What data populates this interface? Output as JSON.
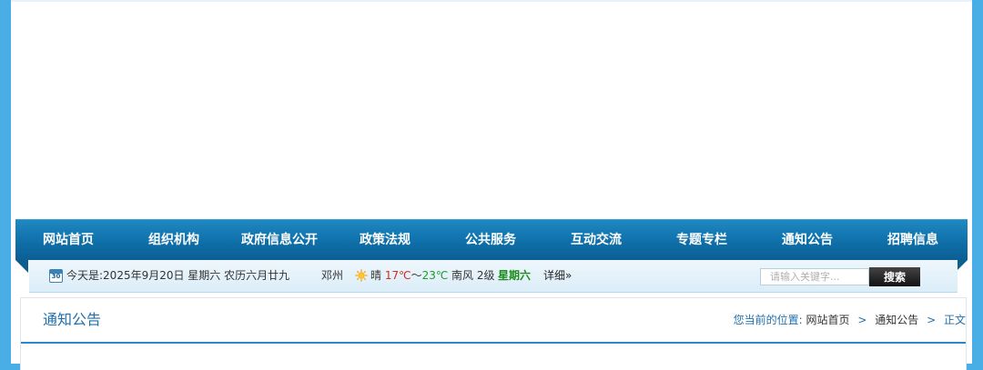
{
  "nav": {
    "items": [
      {
        "label": "网站首页"
      },
      {
        "label": "组织机构"
      },
      {
        "label": "政府信息公开"
      },
      {
        "label": "政策法规"
      },
      {
        "label": "公共服务"
      },
      {
        "label": "互动交流"
      },
      {
        "label": "专题专栏"
      },
      {
        "label": "通知公告"
      },
      {
        "label": "招聘信息"
      }
    ]
  },
  "info": {
    "calendar_day": "30",
    "date_text": "今天是:2025年9月20日 星期六 农历六月廿九",
    "city": "邓州",
    "weather_desc": "晴",
    "temp_high": "17℃",
    "temp_sep": "～",
    "temp_low": "23℃",
    "wind": "南风 2级",
    "weekday": "星期六",
    "detail_label": "详细»"
  },
  "search": {
    "placeholder": "请输入关键字...",
    "button_label": "搜索"
  },
  "content": {
    "section_title": "通知公告",
    "breadcrumb": {
      "prefix": "您当前的位置:",
      "home": "网站首页",
      "sep": ">",
      "category": "通知公告",
      "current": "正文"
    }
  },
  "colors": {
    "side_background": "#4aaee6",
    "nav_blue": "#0f6fa9",
    "accent_blue": "#1f6fab",
    "temp_high": "#d02b1e",
    "temp_low": "#1b9b2a"
  }
}
